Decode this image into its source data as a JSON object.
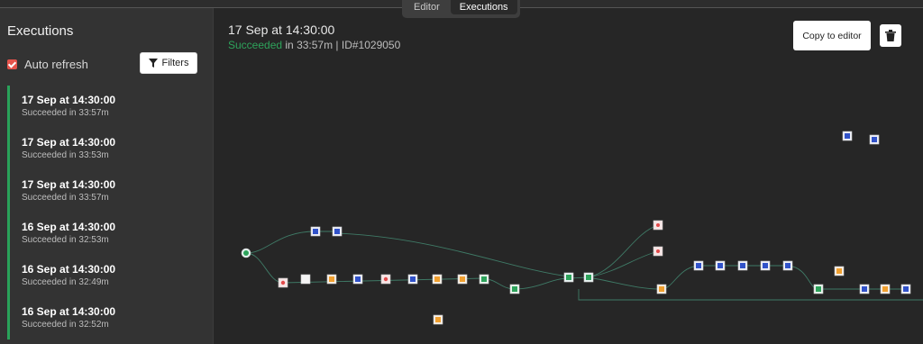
{
  "tabs": [
    {
      "label": "Editor",
      "active": false
    },
    {
      "label": "Executions",
      "active": true
    }
  ],
  "sidebar": {
    "title": "Executions",
    "auto_refresh_label": "Auto refresh",
    "auto_refresh_checked": true,
    "filters_label": "Filters",
    "items": [
      {
        "date": "17 Sep at 14:30:00",
        "status": "Succeeded in 33:57m"
      },
      {
        "date": "17 Sep at 14:30:00",
        "status": "Succeeded in 33:53m"
      },
      {
        "date": "17 Sep at 14:30:00",
        "status": "Succeeded in 33:57m"
      },
      {
        "date": "16 Sep at 14:30:00",
        "status": "Succeeded in 32:53m"
      },
      {
        "date": "16 Sep at 14:30:00",
        "status": "Succeeded in 32:49m"
      },
      {
        "date": "16 Sep at 14:30:00",
        "status": "Succeeded in 32:52m"
      }
    ]
  },
  "execution": {
    "title": "17 Sep at 14:30:00",
    "status": "Succeeded",
    "duration": "in 33:57m | ID#1029050"
  },
  "actions": {
    "copy_label": "Copy to editor",
    "delete_icon": "trash-icon"
  },
  "colors": {
    "success": "#2ea35b",
    "checkbox": "#e5534b",
    "canvas_bg": "#262626",
    "sidebar_bg": "#333333"
  }
}
